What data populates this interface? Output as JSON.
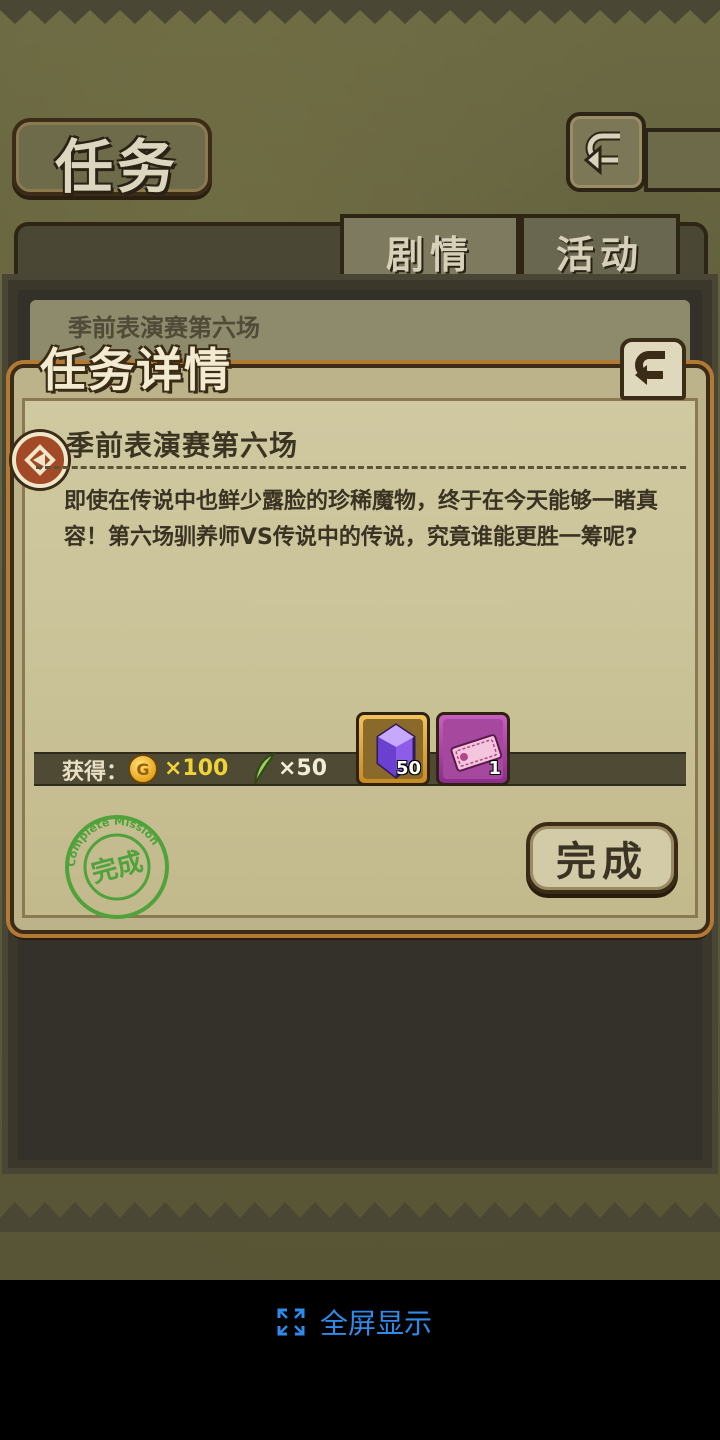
{
  "screen": {
    "title": "任务",
    "tabs": [
      {
        "label": "剧情",
        "active": true
      },
      {
        "label": "活动",
        "active": false
      }
    ],
    "background_mission_title": "季前表演赛第六场"
  },
  "dialog": {
    "title": "任务详情",
    "mission_title": "季前表演赛第六场",
    "description": "即使在传说中也鲜少露脸的珍稀魔物，终于在今天能够一睹真容！第六场驯养师VS传说中的传说，究竟谁能更胜一筹呢?",
    "rewards_label": "获得：",
    "rewards": {
      "coin": {
        "icon": "gold-coin-icon",
        "glyph": "G",
        "amount": "×100"
      },
      "feather": {
        "icon": "feather-icon",
        "amount": "×50"
      },
      "items": [
        {
          "name": "crystal",
          "icon": "purple-crystal-icon",
          "count": "50"
        },
        {
          "name": "ticket",
          "icon": "ticket-icon",
          "count": "1"
        }
      ]
    },
    "stamp_text": "完成",
    "stamp_ring_text": "Complete Mission",
    "complete_button": "完成"
  },
  "footer": {
    "fullscreen_label": "全屏显示",
    "icon": "expand-icon"
  },
  "colors": {
    "accent_orange": "#b47a34",
    "coin_yellow": "#f0d437",
    "link_blue": "#2e8bea",
    "stamp_green": "#4fa33a"
  }
}
